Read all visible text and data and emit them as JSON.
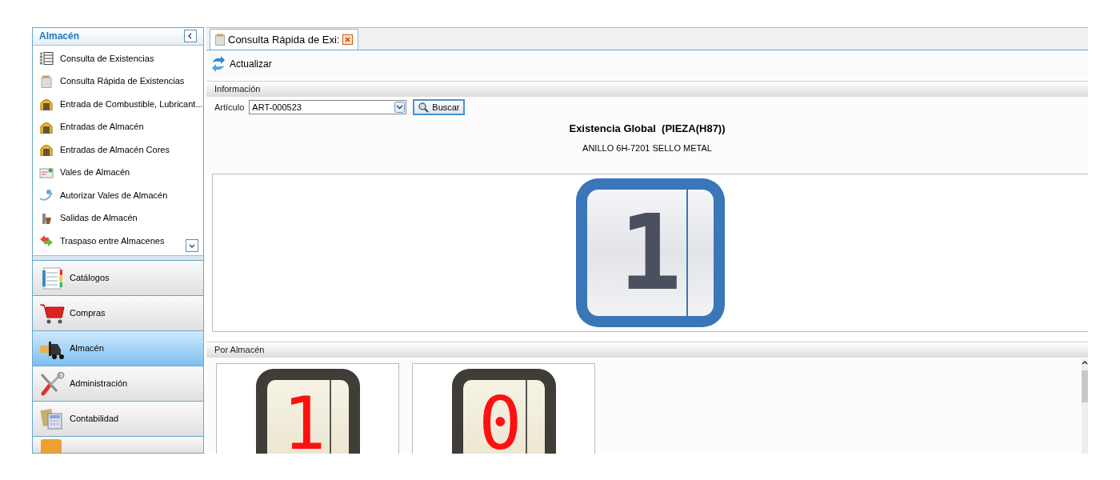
{
  "sidebar": {
    "title": "Almacén",
    "items": [
      {
        "label": "Consulta de Existencias",
        "kind": "list"
      },
      {
        "label": "Consulta Rápida de Existencias",
        "kind": "calc"
      },
      {
        "label": "Entrada de Combustible, Lubricant...",
        "kind": "gate"
      },
      {
        "label": "Entradas de Almacén",
        "kind": "gate"
      },
      {
        "label": "Entradas de Almacén Cores",
        "kind": "gate"
      },
      {
        "label": "Vales de Almacén",
        "kind": "voucher"
      },
      {
        "label": "Autorizar Vales de Almacén",
        "kind": "authorize"
      },
      {
        "label": "Salidas de Almacén",
        "kind": "exit"
      },
      {
        "label": "Traspaso entre Almacenes",
        "kind": "transfer"
      }
    ],
    "nav": [
      {
        "label": "Catálogos",
        "kind": "catalog",
        "selected": false
      },
      {
        "label": "Compras",
        "kind": "cart",
        "selected": false
      },
      {
        "label": "Almacén",
        "kind": "forklift",
        "selected": true
      },
      {
        "label": "Administración",
        "kind": "tools",
        "selected": false
      },
      {
        "label": "Contabilidad",
        "kind": "accounting",
        "selected": false
      }
    ]
  },
  "tab": {
    "label": "Consulta Rápida de Exi:"
  },
  "toolbar": {
    "refresh": "Actualizar"
  },
  "info": {
    "title": "Información",
    "field_label": "Artículo",
    "value": "ART-000523",
    "search": "Buscar",
    "heading": "Existencia Global  (PIEZA(H87))",
    "description": "ANILLO 6H-7201 SELLO METAL",
    "display": "1"
  },
  "by_warehouse": {
    "title": "Por Almacén",
    "displays": [
      {
        "value": "1"
      },
      {
        "value": "0"
      }
    ]
  }
}
